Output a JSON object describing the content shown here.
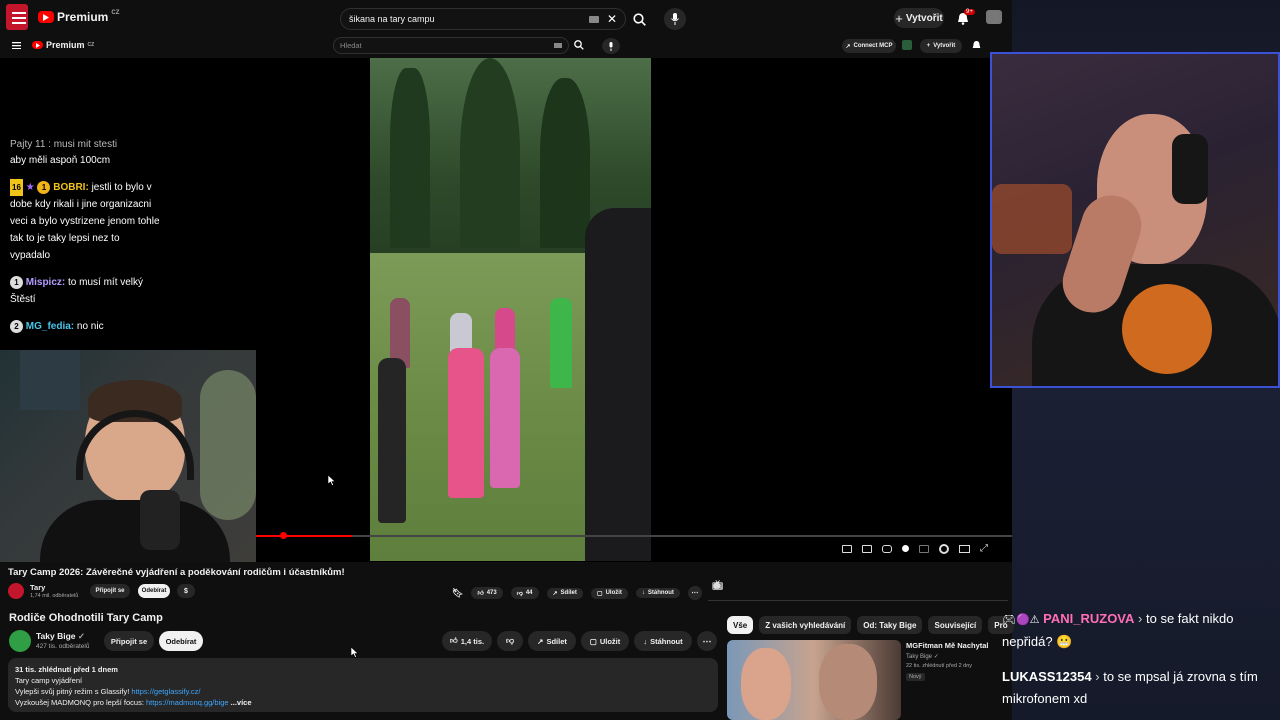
{
  "outer_bar": {
    "brand": "Premium",
    "brand_region": "CZ",
    "search_value": "šikana na tary campu",
    "create_label": "Vytvořit",
    "notif_count": "9+"
  },
  "inner_bar": {
    "brand": "Premium",
    "brand_region": "CZ",
    "search_placeholder": "Hledat",
    "connect_label": "Connect MCP",
    "create_label": "Vytvořit"
  },
  "left_chat": {
    "messages": [
      {
        "badge": "",
        "user": "",
        "text": "Pajty 11 : musi mit stesti"
      },
      {
        "badge": "",
        "user": "",
        "text": "aby měli aspoň 100cm"
      },
      {
        "badge": "16",
        "badge2": "1",
        "user": "BOBRI:",
        "text": "jestli to bylo v dobe kdy rikali i jine organizacni veci a bylo vystrizene jenom tohle tak to je taky lepsi nez to vypadalo"
      },
      {
        "badge": "1",
        "user": "Mispicz:",
        "text": "to musí mít velký Štěstí"
      },
      {
        "badge": "2",
        "user": "MG_fedia:",
        "text": "no nic"
      }
    ]
  },
  "inner_video": {
    "title": "Tary Camp 2026: Závěrečné vyjádření a poděkování rodičům i účastníkům!",
    "channel": "Tary",
    "subscribers": "1,74 mil. odběratelů",
    "join_label": "Připojit se",
    "subscribe_label": "Odebírat",
    "likes": "473",
    "dislikes": "44",
    "share_label": "Sdílet",
    "save_label": "Uložit",
    "download_label": "Stáhnout"
  },
  "outer_video": {
    "title": "Rodiče Ohodnotili Tary Camp",
    "channel": "Taky Bige",
    "subscribers": "427 tis. odběratelů",
    "join_label": "Připojit se",
    "subscribe_label": "Odebírat",
    "likes": "1,4 tis.",
    "share_label": "Sdílet",
    "save_label": "Uložit",
    "download_label": "Stáhnout",
    "description": {
      "meta": "31 tis. zhlédnutí  před 1 dnem",
      "line1": "Tary camp vyjádření",
      "line2_prefix": "Vylepši svůj pitný režim s Glassify! ",
      "line2_link": "https://getglassify.cz/",
      "line3_prefix": "Vyzkoušej MADMONQ pro lepší focus: ",
      "line3_link": "https://madmonq.gg/bige",
      "more_label": "...více"
    }
  },
  "recommend": {
    "chips": [
      "Vše",
      "Z vašich vyhledávání",
      "Od: Taky Bige",
      "Související",
      "Pro"
    ],
    "item": {
      "title": "MGFitman Mě Nachytal",
      "channel": "Taky Bige",
      "meta": "22 tis. zhlédnutí  před 2 dny",
      "badge": "Nový"
    }
  },
  "right_chat": {
    "messages": [
      {
        "user": "PANI_RUZOVA",
        "text": "to se fakt nikdo nepřidá? 😬"
      },
      {
        "user": "LUKASS12354",
        "text": "to se mpsal já zrovna s tím mikrofonem xd"
      }
    ]
  },
  "colors": {
    "accent_red": "#ff0000",
    "link_blue": "#3ea6ff",
    "stream_frame": "#3b52d8",
    "chat_pink": "#ff6fb4"
  }
}
